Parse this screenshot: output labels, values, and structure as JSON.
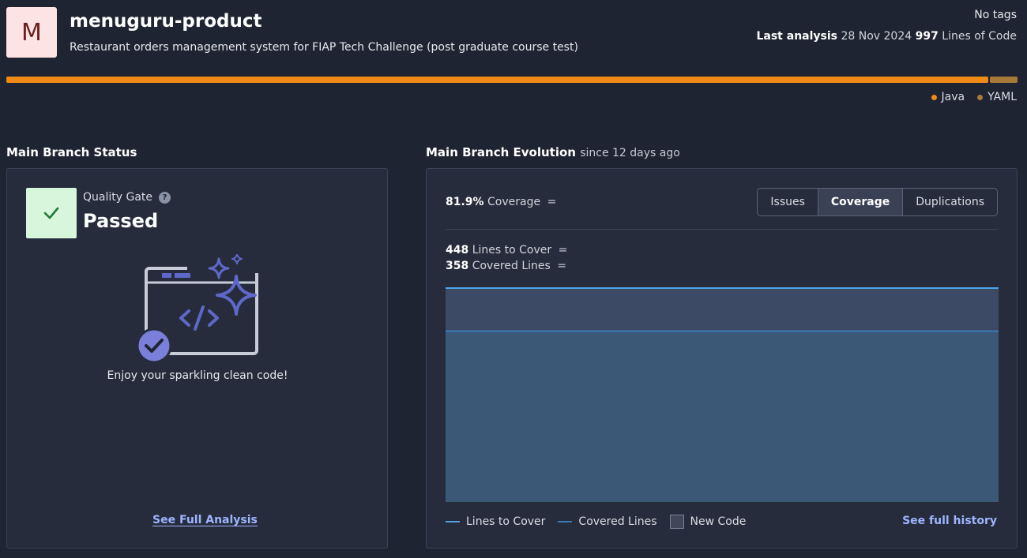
{
  "project": {
    "avatar_letter": "M",
    "name": "menuguru-product",
    "description": "Restaurant orders management system for FIAP Tech Challenge (post graduate course test)",
    "tags": "No tags",
    "last_analysis_label": "Last analysis",
    "last_analysis_date": "28 Nov 2024",
    "loc_value": "997",
    "loc_label": "Lines of Code"
  },
  "languages": [
    {
      "name": "Java",
      "share": 0.973,
      "color": "#ef8a17"
    },
    {
      "name": "YAML",
      "share": 0.027,
      "color": "#a87a3a"
    }
  ],
  "status": {
    "section_title": "Main Branch Status",
    "qg_label": "Quality Gate",
    "help_icon": "?",
    "qg_status": "Passed",
    "message": "Enjoy your sparkling clean code!",
    "see_full_analysis": "See Full Analysis"
  },
  "evolution": {
    "section_title": "Main Branch Evolution",
    "since": "since 12 days ago",
    "coverage_value": "81.9%",
    "coverage_label": "Coverage",
    "trend_symbol": "=",
    "tabs": [
      {
        "label": "Issues",
        "active": false
      },
      {
        "label": "Coverage",
        "active": true
      },
      {
        "label": "Duplications",
        "active": false
      }
    ],
    "lines_to_cover_value": "448",
    "lines_to_cover_label": "Lines to Cover",
    "covered_lines_value": "358",
    "covered_lines_label": "Covered Lines",
    "legend": {
      "lines_to_cover": "Lines to Cover",
      "covered_lines": "Covered Lines",
      "new_code": "New Code"
    },
    "see_full_history": "See full history"
  },
  "colors": {
    "lines_to_cover": "#4ea3e6",
    "covered_lines": "#3a7bb8",
    "area_top": "#3d4a66",
    "area_bottom": "#3b5877"
  },
  "chart_data": {
    "type": "area",
    "series": [
      {
        "name": "Lines to Cover",
        "values": [
          448,
          448,
          448
        ]
      },
      {
        "name": "Covered Lines",
        "values": [
          358,
          358,
          358
        ]
      }
    ],
    "ylim": [
      0,
      448
    ],
    "xlabel": "",
    "ylabel": "",
    "legend": [
      "Lines to Cover",
      "Covered Lines",
      "New Code"
    ]
  }
}
